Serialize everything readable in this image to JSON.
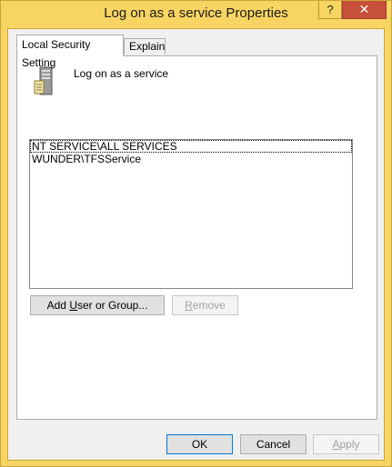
{
  "window": {
    "title": "Log on as a service Properties",
    "help_label": "?",
    "close_label": "✕",
    "frame_color": "#f8d563",
    "close_color": "#c7503b"
  },
  "tabs": [
    {
      "label": "Local Security Setting",
      "active": true
    },
    {
      "label": "Explain",
      "active": false
    }
  ],
  "policy": {
    "icon": "server-policy-icon",
    "name": "Log on as a service"
  },
  "members": [
    {
      "label": "NT SERVICE\\ALL SERVICES",
      "selected": true
    },
    {
      "label": "WUNDER\\TFSService",
      "selected": false
    }
  ],
  "actions": {
    "add_pre": "Add ",
    "add_mnemonic": "U",
    "add_post": "ser or Group...",
    "remove_mnemonic": "R",
    "remove_post": "emove"
  },
  "footer": {
    "ok": "OK",
    "cancel": "Cancel",
    "apply_mnemonic": "A",
    "apply_post": "pply"
  }
}
